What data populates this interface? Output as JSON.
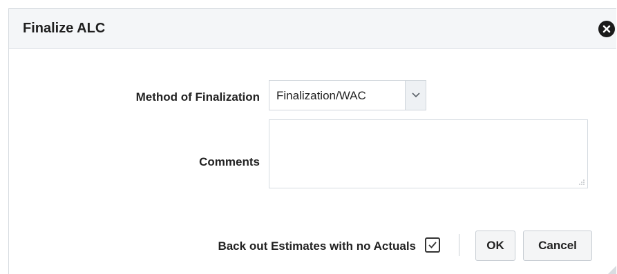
{
  "dialog": {
    "title": "Finalize ALC",
    "close_icon": "close-circle-icon"
  },
  "form": {
    "method_label": "Method of Finalization",
    "method_value": "Finalization/WAC",
    "comments_label": "Comments",
    "comments_value": "",
    "backout_label": "Back out Estimates with no Actuals",
    "backout_checked": true
  },
  "buttons": {
    "ok_label": "OK",
    "cancel_label": "Cancel"
  },
  "colors": {
    "header_bg": "#f4f6f8",
    "button_bg": "#f4f5f6",
    "text": "#222222"
  }
}
